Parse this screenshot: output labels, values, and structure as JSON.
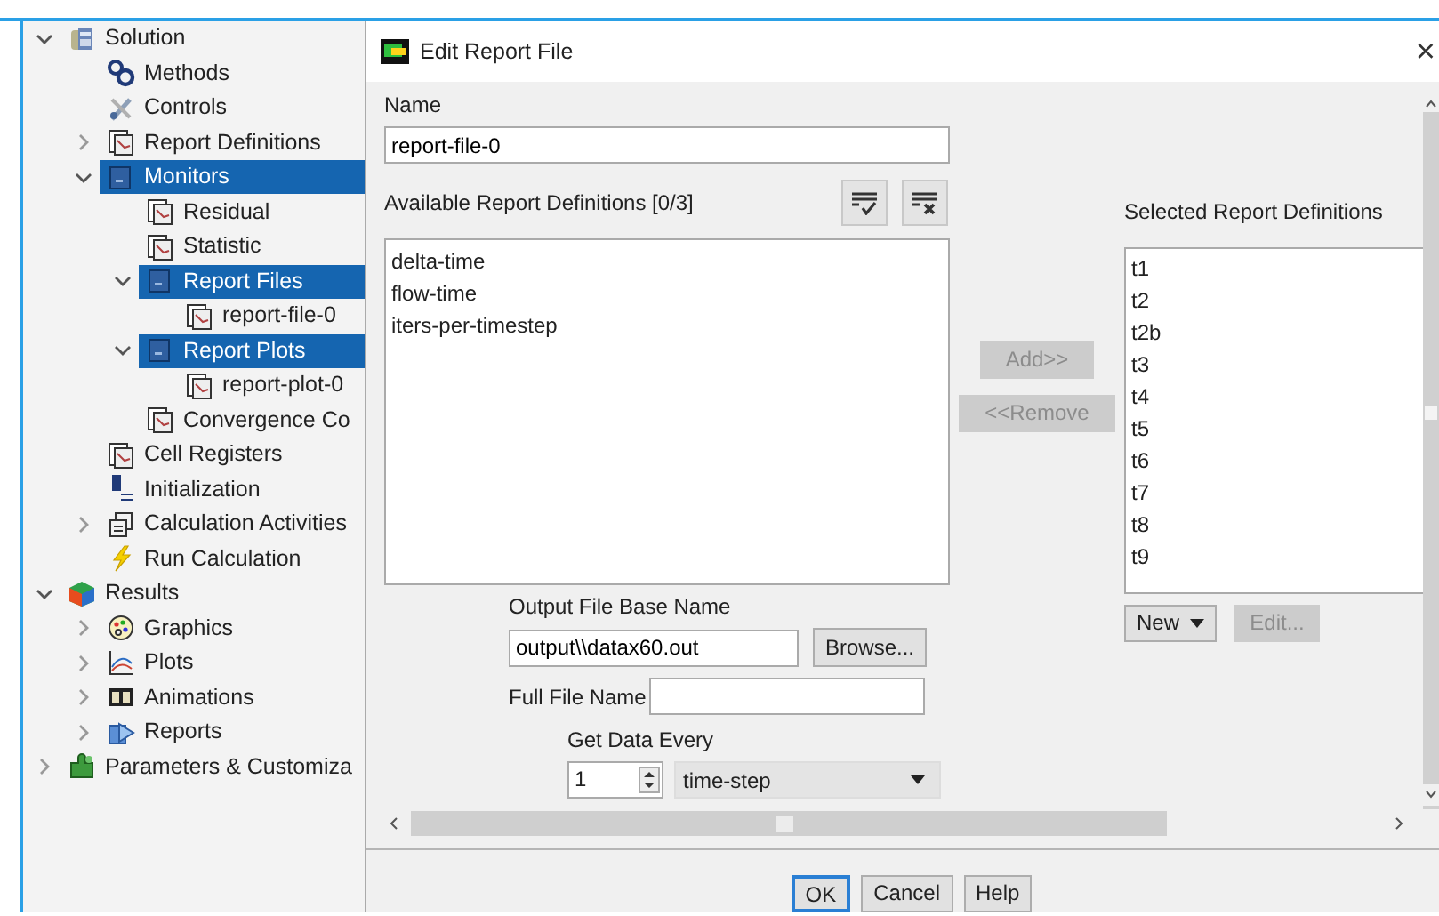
{
  "sidebar": {
    "tree": [
      {
        "label": "Solution",
        "kind": "solution",
        "selected": false,
        "expanded": true,
        "children": [
          {
            "label": "Methods",
            "kind": "methods",
            "selected": false
          },
          {
            "label": "Controls",
            "kind": "controls",
            "selected": false
          },
          {
            "label": "Report Definitions",
            "kind": "report",
            "selected": false,
            "expanded": false
          },
          {
            "label": "Monitors",
            "kind": "folder",
            "selected": true,
            "expanded": true,
            "children": [
              {
                "label": "Residual",
                "kind": "report",
                "selected": false
              },
              {
                "label": "Statistic",
                "kind": "report",
                "selected": false
              },
              {
                "label": "Report Files",
                "kind": "folder",
                "selected": true,
                "expanded": true,
                "children": [
                  {
                    "label": "report-file-0",
                    "kind": "report",
                    "selected": false
                  }
                ]
              },
              {
                "label": "Report Plots",
                "kind": "folder",
                "selected": true,
                "expanded": true,
                "children": [
                  {
                    "label": "report-plot-0",
                    "kind": "report",
                    "selected": false
                  }
                ]
              },
              {
                "label": "Convergence Co",
                "kind": "report",
                "selected": false
              }
            ]
          },
          {
            "label": "Cell Registers",
            "kind": "report",
            "selected": false
          },
          {
            "label": "Initialization",
            "kind": "init",
            "selected": false
          },
          {
            "label": "Calculation Activities",
            "kind": "activities",
            "selected": false,
            "expanded": false
          },
          {
            "label": "Run Calculation",
            "kind": "run",
            "selected": false
          }
        ]
      },
      {
        "label": "Results",
        "kind": "results",
        "selected": false,
        "expanded": true,
        "children": [
          {
            "label": "Graphics",
            "kind": "graphics",
            "selected": false,
            "expanded": false
          },
          {
            "label": "Plots",
            "kind": "plots",
            "selected": false,
            "expanded": false
          },
          {
            "label": "Animations",
            "kind": "animations",
            "selected": false,
            "expanded": false
          },
          {
            "label": "Reports",
            "kind": "reports",
            "selected": false,
            "expanded": false
          }
        ]
      },
      {
        "label": "Parameters & Customiza",
        "kind": "parameters",
        "selected": false,
        "expanded": false
      }
    ]
  },
  "dialog": {
    "title": "Edit Report File",
    "close": "×",
    "name": {
      "label": "Name",
      "value": "report-file-0"
    },
    "available": {
      "label": "Available Report Definitions [0/3]",
      "items": [
        {
          "label": "delta-time",
          "selected": false
        },
        {
          "label": "flow-time",
          "selected": false
        },
        {
          "label": "iters-per-timestep",
          "selected": false
        }
      ]
    },
    "add_button": {
      "label": "Add>>",
      "disabled": true
    },
    "remove_button": {
      "label": "<<Remove",
      "disabled": true
    },
    "selected_definitions": {
      "label": "Selected Report Definitions",
      "items": [
        {
          "label": "t1",
          "selected": false
        },
        {
          "label": "t2",
          "selected": false
        },
        {
          "label": "t2b",
          "selected": false
        },
        {
          "label": "t3",
          "selected": false
        },
        {
          "label": "t4",
          "selected": false
        },
        {
          "label": "t5",
          "selected": false
        },
        {
          "label": "t6",
          "selected": false
        },
        {
          "label": "t7",
          "selected": false
        },
        {
          "label": "t8",
          "selected": false
        },
        {
          "label": "t9",
          "selected": false
        }
      ]
    },
    "new_button": {
      "label": "New",
      "disabled": false
    },
    "edit_button": {
      "label": "Edit...",
      "disabled": true
    },
    "output_base": {
      "label": "Output File Base Name",
      "value": "output\\\\datax60.out"
    },
    "browse_button": {
      "label": "Browse...",
      "disabled": false
    },
    "full_file_name": {
      "label": "Full File Name"
    },
    "get_data": {
      "label": "Get Data Every",
      "count": "1",
      "unit": "time-step"
    },
    "buttons": [
      {
        "label": "OK",
        "focused": true
      },
      {
        "label": "Cancel",
        "focused": false
      },
      {
        "label": "Help",
        "focused": false
      }
    ]
  }
}
